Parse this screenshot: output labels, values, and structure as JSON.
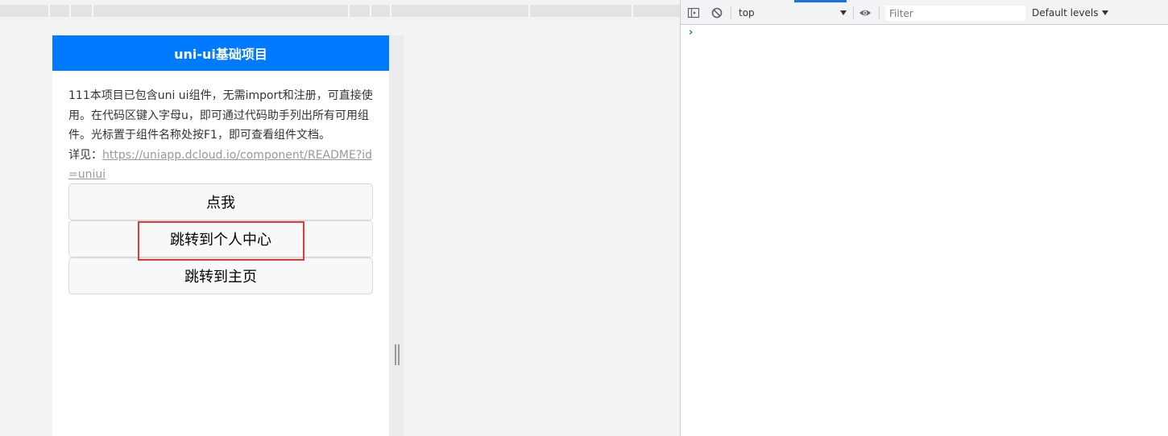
{
  "device": {
    "navbar_title": "uni-ui基础项目",
    "intro_text": "111本项目已包含uni ui组件，无需import和注册，可直接使用。在代码区键入字母u，即可通过代码助手列出所有可用组件。光标置于组件名称处按F1，即可查看组件文档。",
    "details_label": "详见：",
    "details_link": "https://uniapp.dcloud.io/component/README?id=uniui",
    "buttons": [
      {
        "label": "点我"
      },
      {
        "label": "跳转到个人中心"
      },
      {
        "label": "跳转到主页"
      }
    ],
    "navbar_color": "#007aff",
    "highlight_color": "#e53935"
  },
  "devtools": {
    "context": "top",
    "filter_placeholder": "Filter",
    "levels_label": "Default levels",
    "prompt_symbol": "›",
    "icons": [
      "sidebar-toggle-icon",
      "clear-console-icon",
      "dropdown-arrow-icon",
      "eye-icon"
    ]
  }
}
